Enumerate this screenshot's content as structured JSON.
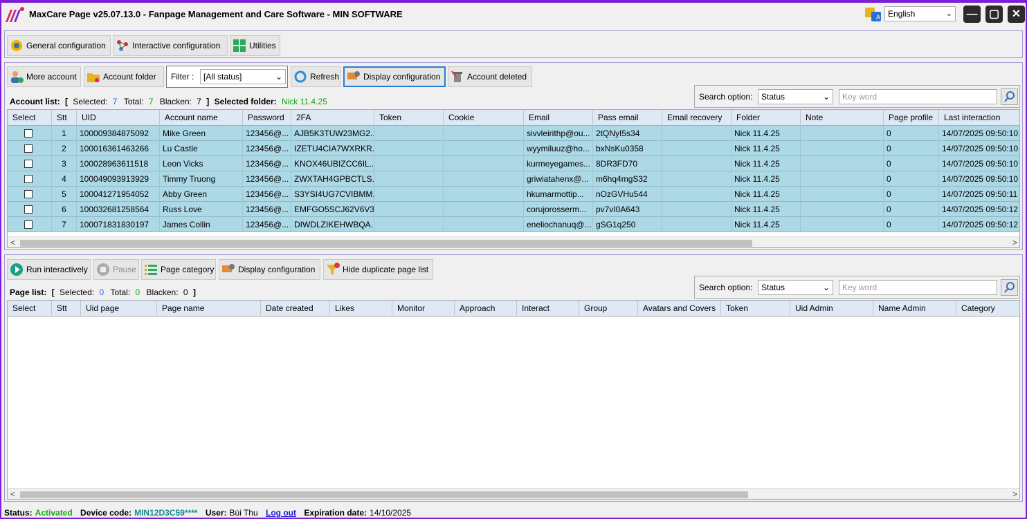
{
  "window": {
    "title": "MaxCare Page v25.07.13.0 -  Fanpage Management and Care Software - MIN SOFTWARE",
    "language": "English",
    "accent": "#7a1fd6"
  },
  "tabs": {
    "general": "General configuration",
    "interactive": "Interactive configuration",
    "utilities": "Utilities"
  },
  "account_toolbar": {
    "more_account": "More account",
    "account_folder": "Account folder",
    "filter_label": "Filter :",
    "filter_value": "[All status]",
    "refresh": "Refresh",
    "display_config": "Display configuration",
    "account_deleted": "Account deleted"
  },
  "account_summary": {
    "label": "Account list:",
    "open": "[",
    "selected_label": "Selected:",
    "selected": "7",
    "total_label": "Total:",
    "total": "7",
    "blacken_label": "Blacken:",
    "blacken": "7",
    "close": "]",
    "folder_label": "Selected folder:",
    "folder": "Nick 11.4.25"
  },
  "search": {
    "label": "Search option:",
    "option": "Status",
    "placeholder": "Key word"
  },
  "account_columns": [
    "Select",
    "Stt",
    "UID",
    "Account name",
    "Password",
    "2FA",
    "Token",
    "Cookie",
    "Email",
    "Pass email",
    "Email recovery",
    "Folder",
    "Note",
    "Page profile",
    "Last interaction"
  ],
  "accounts": [
    [
      "",
      "1",
      "100009384875092",
      "Mike Green",
      "123456@...",
      "AJB5K3TUW23MG2...",
      "",
      "",
      "sivvleirithp@ou...",
      "2tQNyI5s34",
      "",
      "Nick 11.4.25",
      "",
      "0",
      "14/07/2025 09:50:10"
    ],
    [
      "",
      "2",
      "100016361463266",
      "Lu Castle",
      "123456@...",
      "IZETU4CIA7WXRKR...",
      "",
      "",
      "wyymiluuz@ho...",
      "bxNsKu0358",
      "",
      "Nick 11.4.25",
      "",
      "0",
      "14/07/2025 09:50:10"
    ],
    [
      "",
      "3",
      "100028963611518",
      "Leon Vicks",
      "123456@...",
      "KNOX46UBIZCC6IL...",
      "",
      "",
      "kurmeyegames...",
      "8DR3FD70",
      "",
      "Nick 11.4.25",
      "",
      "0",
      "14/07/2025 09:50:10"
    ],
    [
      "",
      "4",
      "100049093913929",
      "Timmy Truong",
      "123456@...",
      "ZWXTAH4GPBCTLS...",
      "",
      "",
      "griwiatahenx@...",
      "m6hq4mgS32",
      "",
      "Nick 11.4.25",
      "",
      "0",
      "14/07/2025 09:50:10"
    ],
    [
      "",
      "5",
      "100041271954052",
      "Abby Green",
      "123456@...",
      "S3YSI4UG7CVIBMM...",
      "",
      "",
      "hkumarmottip...",
      "nOzGVHu544",
      "",
      "Nick 11.4.25",
      "",
      "0",
      "14/07/2025 09:50:11"
    ],
    [
      "",
      "6",
      "100032681258564",
      "Russ Love",
      "123456@...",
      "EMFGO5SCJ62V6V3...",
      "",
      "",
      "corujorosserm...",
      "pv7vI0A643",
      "",
      "Nick 11.4.25",
      "",
      "0",
      "14/07/2025 09:50:12"
    ],
    [
      "",
      "7",
      "100071831830197",
      "James Collin",
      "123456@...",
      "DIWDLZIKEHWBQA...",
      "",
      "",
      "eneliochanuq@...",
      "gSG1q250",
      "",
      "Nick 11.4.25",
      "",
      "0",
      "14/07/2025 09:50:12"
    ]
  ],
  "page_toolbar": {
    "run": "Run interactively",
    "pause": "Pause",
    "category": "Page category",
    "display_config": "Display configuration",
    "hide_dup": "Hide duplicate page list"
  },
  "page_summary": {
    "label": "Page list:",
    "open": "[",
    "selected_label": "Selected:",
    "selected": "0",
    "total_label": "Total:",
    "total": "0",
    "blacken_label": "Blacken:",
    "blacken": "0",
    "close": "]"
  },
  "page_columns": [
    "Select",
    "Stt",
    "Uid page",
    "Page name",
    "Date created",
    "Likes",
    "Monitor",
    "Approach",
    "Interact",
    "Group",
    "Avatars and Covers",
    "Token",
    "Uid Admin",
    "Name Admin",
    "Category"
  ],
  "status": {
    "label": "Status:",
    "value": "Activated",
    "device_label": "Device code:",
    "device": "MIN12D3C59****",
    "user_label": "User:",
    "user": "Bùi Thu",
    "logout": "Log out",
    "expire_label": "Expiration date:",
    "expire": "14/10/2025"
  }
}
